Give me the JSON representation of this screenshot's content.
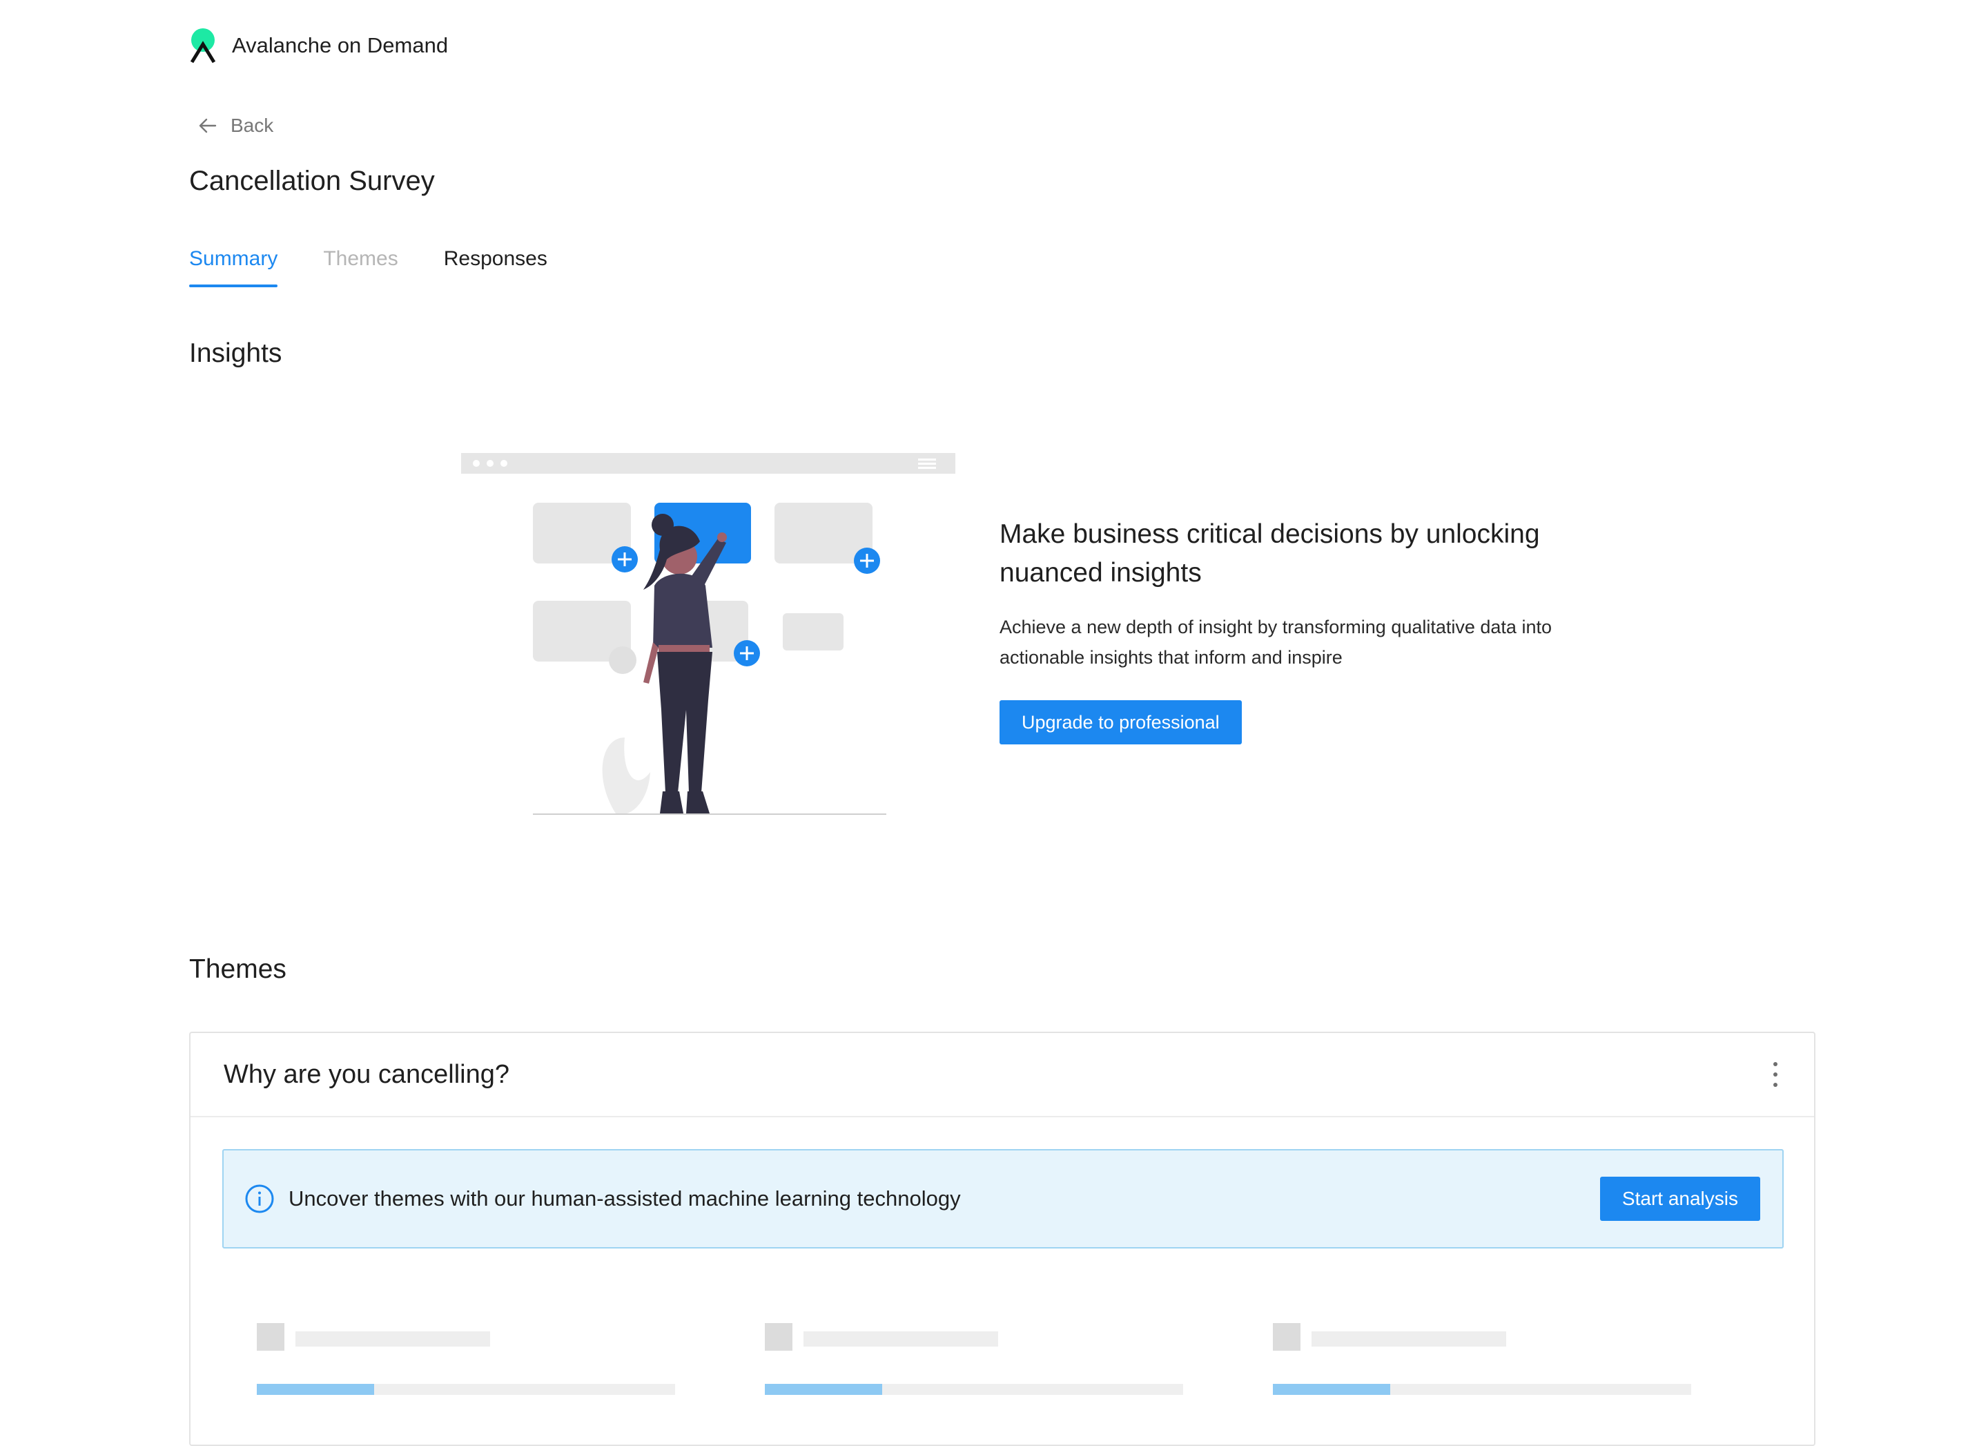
{
  "app": {
    "title": "Avalanche on Demand",
    "logo_colors": [
      "#1de9a4",
      "#111111"
    ]
  },
  "nav": {
    "back_label": "Back"
  },
  "page": {
    "title": "Cancellation Survey"
  },
  "tabs": [
    {
      "label": "Summary",
      "state": "active"
    },
    {
      "label": "Themes",
      "state": "disabled"
    },
    {
      "label": "Responses",
      "state": "normal"
    }
  ],
  "insights": {
    "heading": "Insights",
    "promo_title": "Make business critical decisions by unlocking nuanced insights",
    "promo_text": "Achieve a new depth of insight by transforming qualitative data into actionable insights that inform and inspire",
    "upgrade_label": "Upgrade to professional"
  },
  "themes": {
    "heading": "Themes",
    "card": {
      "question": "Why are you cancelling?",
      "banner_text": "Uncover themes with our human-assisted machine learning technology",
      "start_label": "Start analysis",
      "skeleton_progress": [
        0.28,
        0.28,
        0.28
      ]
    }
  },
  "colors": {
    "accent": "#1c88f0",
    "banner_bg": "#e6f4fc",
    "banner_border": "#9fd4f2",
    "disabled_text": "#b5b5b5"
  }
}
